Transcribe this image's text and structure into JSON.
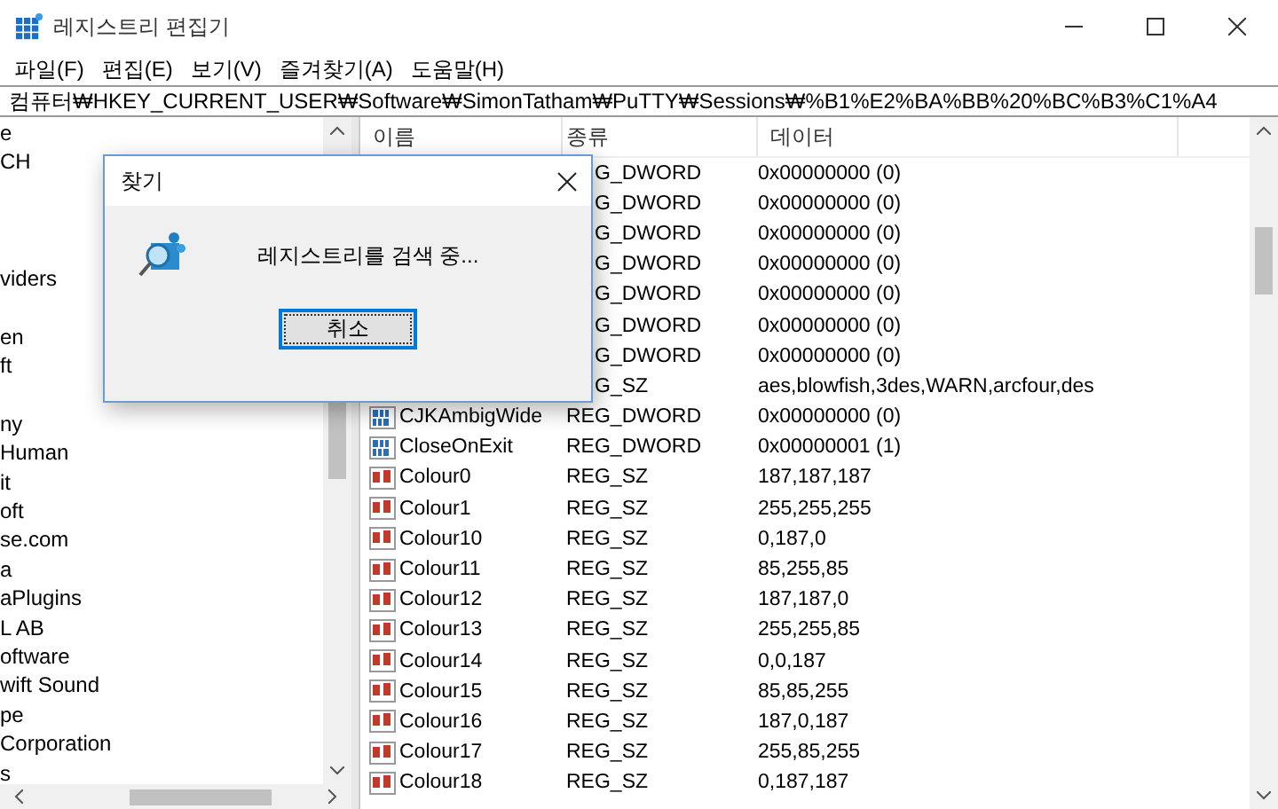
{
  "window": {
    "title": "레지스트리 편집기"
  },
  "menu": [
    "파일(F)",
    "편집(E)",
    "보기(V)",
    "즐겨찾기(A)",
    "도움말(H)"
  ],
  "address": "컴퓨터₩HKEY_CURRENT_USER₩Software₩SimonTatham₩PuTTY₩Sessions₩%B1%E2%BA%BB%20%BC%B3%C1%A4",
  "tree": [
    {
      "text": "e"
    },
    {
      "text": "CH"
    },
    {
      "kind": "clipped"
    },
    {
      "kind": "clipped"
    },
    {
      "kind": "clipped"
    },
    {
      "text": "viders"
    },
    {
      "kind": "clipped"
    },
    {
      "text": "en"
    },
    {
      "text": "ft"
    },
    {
      "kind": "clipped"
    },
    {
      "text": "ny"
    },
    {
      "text": "Human"
    },
    {
      "text": "it"
    },
    {
      "text": "oft"
    },
    {
      "text": "se.com"
    },
    {
      "text": "a"
    },
    {
      "text": "aPlugins"
    },
    {
      "text": "L AB"
    },
    {
      "text": "oftware"
    },
    {
      "text": "wift Sound"
    },
    {
      "text": "pe"
    },
    {
      "text": "Corporation"
    },
    {
      "text": "s"
    }
  ],
  "table": {
    "columns": [
      "이름",
      "종류",
      "데이터"
    ],
    "rows": [
      {
        "kind": "covered",
        "type": "G_DWORD",
        "data": "0x00000000 (0)"
      },
      {
        "kind": "covered",
        "type": "G_DWORD",
        "data": "0x00000000 (0)"
      },
      {
        "kind": "covered",
        "type": "G_DWORD",
        "data": "0x00000000 (0)"
      },
      {
        "kind": "covered",
        "type": "G_DWORD",
        "data": "0x00000000 (0)"
      },
      {
        "kind": "covered",
        "type": "G_DWORD",
        "data": "0x00000000 (0)"
      },
      {
        "kind": "covered",
        "type": "G_DWORD",
        "data": "0x00000000 (0)"
      },
      {
        "kind": "covered",
        "type": "G_DWORD",
        "data": "0x00000000 (0)"
      },
      {
        "kind": "covered",
        "type": "G_SZ",
        "data": "aes,blowfish,3des,WARN,arcfour,des"
      },
      {
        "kind": "dword",
        "name": "CJKAmbigWide",
        "type": "REG_DWORD",
        "data": "0x00000000 (0)"
      },
      {
        "kind": "dword",
        "name": "CloseOnExit",
        "type": "REG_DWORD",
        "data": "0x00000001 (1)"
      },
      {
        "kind": "sz",
        "name": "Colour0",
        "type": "REG_SZ",
        "data": "187,187,187"
      },
      {
        "kind": "sz",
        "name": "Colour1",
        "type": "REG_SZ",
        "data": "255,255,255"
      },
      {
        "kind": "sz",
        "name": "Colour10",
        "type": "REG_SZ",
        "data": "0,187,0"
      },
      {
        "kind": "sz",
        "name": "Colour11",
        "type": "REG_SZ",
        "data": "85,255,85"
      },
      {
        "kind": "sz",
        "name": "Colour12",
        "type": "REG_SZ",
        "data": "187,187,0"
      },
      {
        "kind": "sz",
        "name": "Colour13",
        "type": "REG_SZ",
        "data": "255,255,85"
      },
      {
        "kind": "sz",
        "name": "Colour14",
        "type": "REG_SZ",
        "data": "0,0,187"
      },
      {
        "kind": "sz",
        "name": "Colour15",
        "type": "REG_SZ",
        "data": "85,85,255"
      },
      {
        "kind": "sz",
        "name": "Colour16",
        "type": "REG_SZ",
        "data": "187,0,187"
      },
      {
        "kind": "sz",
        "name": "Colour17",
        "type": "REG_SZ",
        "data": "255,85,255"
      },
      {
        "kind": "sz",
        "name": "Colour18",
        "type": "REG_SZ",
        "data": "0,187,187"
      }
    ]
  },
  "dialog": {
    "title": "찾기",
    "message": "레지스트리를 검색 중...",
    "button": {
      "label": "취소",
      "focused": true
    }
  }
}
